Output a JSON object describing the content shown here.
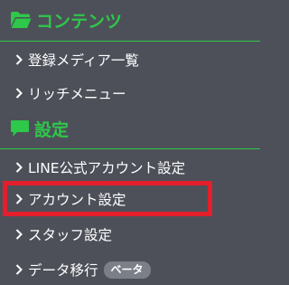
{
  "sections": [
    {
      "icon": "folder-open-icon",
      "title": "コンテンツ",
      "items": [
        {
          "label": "登録メディア一覧"
        },
        {
          "label": "リッチメニュー"
        }
      ]
    },
    {
      "icon": "speech-bubble-icon",
      "title": "設定",
      "items": [
        {
          "label": "LINE公式アカウント設定"
        },
        {
          "label": "アカウント設定"
        },
        {
          "label": "スタッフ設定"
        },
        {
          "label": "データ移行",
          "badge": "ベータ"
        }
      ]
    }
  ],
  "colors": {
    "background": "#4d5059",
    "accent_green": "#2ec84a",
    "highlight_red": "#e31e2d",
    "badge_bg": "#7b7f87"
  }
}
